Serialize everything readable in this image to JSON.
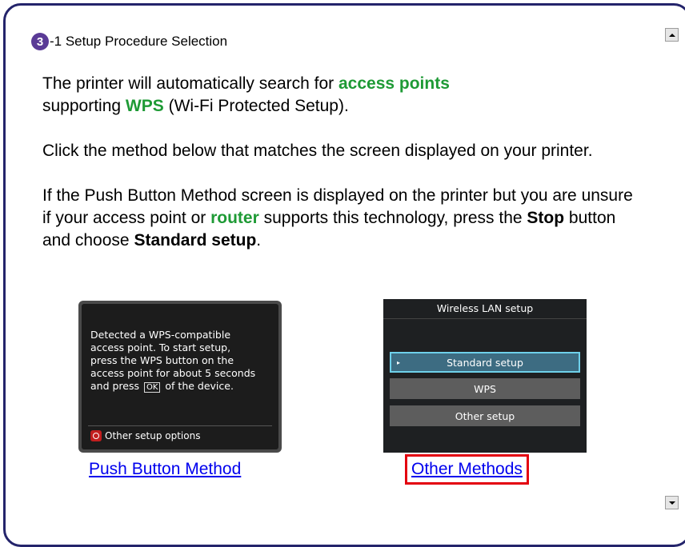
{
  "step": {
    "number": "3",
    "title": "-1 Setup Procedure Selection"
  },
  "intro": {
    "p1": {
      "before": "The printer will automatically search for ",
      "hl1": "access points",
      "mid": " supporting ",
      "hl2": "WPS",
      "after": " (Wi-Fi Protected Setup)."
    },
    "p2": "Click the method below that matches the screen displayed on your printer.",
    "p3": {
      "a": "If the Push Button Method screen is displayed on the printer but you are unsure if your access point or ",
      "hl": "router",
      "b": " supports this technology, press the ",
      "b1": "Stop",
      "c": " button and choose ",
      "b2": "Standard setup",
      "d": "."
    }
  },
  "push_screen": {
    "line1": "Detected a WPS-compatible",
    "line2": "access point. To start setup,",
    "line3": "press the WPS button on the",
    "line4": "access point for about 5 seconds",
    "line5a": "and press ",
    "ok": "OK",
    "line5b": " of the device.",
    "option": "Other setup options"
  },
  "lan_screen": {
    "title": "Wireless LAN setup",
    "items": [
      "Standard setup",
      "WPS",
      "Other setup"
    ]
  },
  "links": {
    "push": "Push Button Method",
    "other": "Other Methods"
  },
  "colors": {
    "highlight": "#1e9a35",
    "frame": "#24246b",
    "badge": "#5a3a96",
    "selected_border": "#e3000f"
  }
}
